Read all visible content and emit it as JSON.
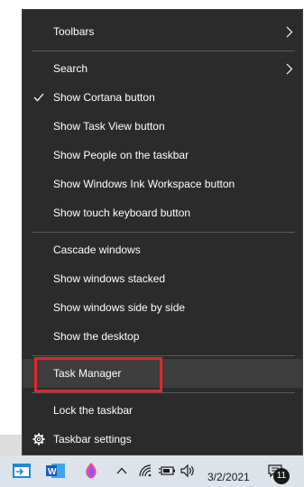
{
  "menu": {
    "items": [
      {
        "label": "Toolbars",
        "submenu": true
      },
      {
        "label": "Search",
        "submenu": true
      },
      {
        "label": "Show Cortana button",
        "checked": true
      },
      {
        "label": "Show Task View button"
      },
      {
        "label": "Show People on the taskbar"
      },
      {
        "label": "Show Windows Ink Workspace button"
      },
      {
        "label": "Show touch keyboard button"
      },
      {
        "label": "Cascade windows"
      },
      {
        "label": "Show windows stacked"
      },
      {
        "label": "Show windows side by side"
      },
      {
        "label": "Show the desktop"
      },
      {
        "label": "Task Manager",
        "highlighted": true,
        "annotation": "red-outline"
      },
      {
        "label": "Lock the taskbar"
      },
      {
        "label": "Taskbar settings",
        "icon": "gear-icon"
      }
    ]
  },
  "taskbar": {
    "date": "3/2/2021",
    "notification_count": "11",
    "icons": [
      "terminal-app-icon",
      "word-icon",
      "paint-3d-icon",
      "chevron-up-icon",
      "network-icon",
      "battery-icon",
      "volume-icon",
      "action-center-icon"
    ]
  },
  "colors": {
    "menu_bg": "#2b2b2b",
    "highlight": "#3d3d3d",
    "annotation": "#e0272b",
    "taskbar_bg": "#dce3ea"
  }
}
